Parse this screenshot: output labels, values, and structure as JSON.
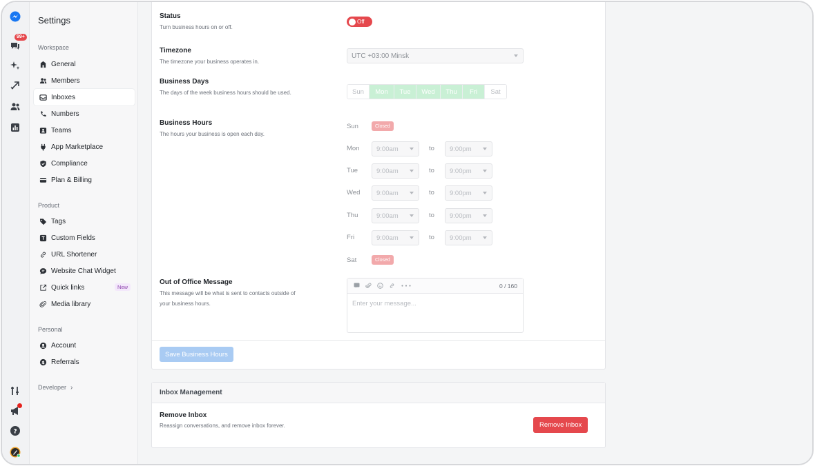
{
  "rail": {
    "notification_count": "99+"
  },
  "sidebar": {
    "title": "Settings",
    "groups": {
      "workspace": "Workspace",
      "product": "Product",
      "personal": "Personal"
    },
    "workspace_items": [
      "General",
      "Members",
      "Inboxes",
      "Numbers",
      "Teams",
      "App Marketplace",
      "Compliance",
      "Plan & Billing"
    ],
    "product_items": [
      "Tags",
      "Custom Fields",
      "URL Shortener",
      "Website Chat Widget",
      "Quick links",
      "Media library"
    ],
    "quick_links_badge": "New",
    "personal_items": [
      "Account",
      "Referrals"
    ],
    "developer": "Developer",
    "active_item": "Inboxes"
  },
  "business_hours": {
    "status": {
      "label": "Status",
      "desc": "Turn business hours on or off.",
      "toggle": "Off"
    },
    "timezone": {
      "label": "Timezone",
      "desc": "The timezone your business operates in.",
      "value": "UTC +03:00 Minsk"
    },
    "days": {
      "label": "Business Days",
      "desc": "The days of the week business hours should be used.",
      "items": [
        {
          "name": "Sun",
          "on": false
        },
        {
          "name": "Mon",
          "on": true
        },
        {
          "name": "Tue",
          "on": true
        },
        {
          "name": "Wed",
          "on": true
        },
        {
          "name": "Thu",
          "on": true
        },
        {
          "name": "Fri",
          "on": true
        },
        {
          "name": "Sat",
          "on": false
        }
      ]
    },
    "hours": {
      "label": "Business Hours",
      "desc": "The hours your business is open each day.",
      "to_label": "to",
      "closed_label": "Closed",
      "rows": [
        {
          "day": "Sun",
          "closed": true
        },
        {
          "day": "Mon",
          "closed": false,
          "from": "9:00am",
          "to": "9:00pm"
        },
        {
          "day": "Tue",
          "closed": false,
          "from": "9:00am",
          "to": "9:00pm"
        },
        {
          "day": "Wed",
          "closed": false,
          "from": "9:00am",
          "to": "9:00pm"
        },
        {
          "day": "Thu",
          "closed": false,
          "from": "9:00am",
          "to": "9:00pm"
        },
        {
          "day": "Fri",
          "closed": false,
          "from": "9:00am",
          "to": "9:00pm"
        },
        {
          "day": "Sat",
          "closed": true
        }
      ]
    },
    "ooo": {
      "label": "Out of Office Message",
      "desc": "This message will be what is sent to contacts outside of your business hours.",
      "counter": "0 / 160",
      "placeholder": "Enter your message..."
    },
    "save_button": "Save Business Hours"
  },
  "inbox_management": {
    "title": "Inbox Management",
    "remove_label": "Remove Inbox",
    "remove_desc": "Reassign conversations, and remove inbox forever.",
    "remove_button": "Remove Inbox"
  },
  "colors": {
    "accent_blue": "#1f7ae0",
    "danger": "#e5484d",
    "day_on": "#c9f0d5",
    "closed_badge": "#f2a9ab"
  }
}
